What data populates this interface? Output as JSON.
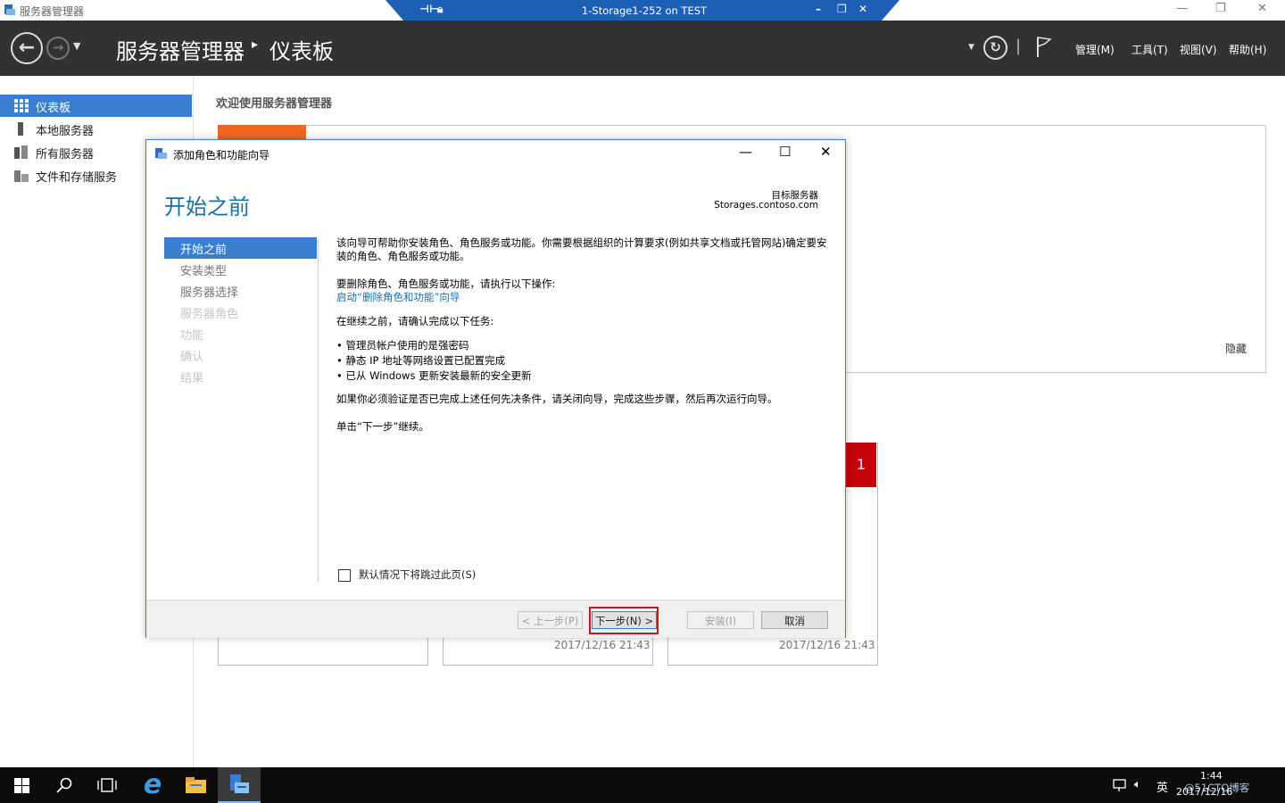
{
  "window": {
    "title": "服务器管理器"
  },
  "rdp": {
    "title": "1-Storage1-252 on TEST"
  },
  "header": {
    "breadcrumb_root": "服务器管理器",
    "breadcrumb_sep": "▸",
    "breadcrumb_page": "仪表板",
    "menu": [
      "管理(M)",
      "工具(T)",
      "视图(V)",
      "帮助(H)"
    ]
  },
  "sidebar": {
    "items": [
      {
        "label": "仪表板",
        "icon": "dashboard-icon",
        "active": true
      },
      {
        "label": "本地服务器",
        "icon": "server-icon"
      },
      {
        "label": "所有服务器",
        "icon": "servers-icon"
      },
      {
        "label": "文件和存储服务",
        "icon": "storage-icon"
      }
    ]
  },
  "dashboard": {
    "welcome": "欢迎使用服务器管理器",
    "hide": "隐藏",
    "badge_count": "1",
    "tile_timestamps": [
      "2017/12/16 21:43",
      "2017/12/16 21:43"
    ]
  },
  "dialog": {
    "title": "添加角色和功能向导",
    "heading": "开始之前",
    "dest_label": "目标服务器",
    "dest_server": "Storages.contoso.com",
    "steps": [
      {
        "label": "开始之前",
        "state": "active"
      },
      {
        "label": "安装类型",
        "state": "enabled"
      },
      {
        "label": "服务器选择",
        "state": "enabled"
      },
      {
        "label": "服务器角色",
        "state": "disabled"
      },
      {
        "label": "功能",
        "state": "disabled"
      },
      {
        "label": "确认",
        "state": "disabled"
      },
      {
        "label": "结果",
        "state": "disabled"
      }
    ],
    "intro": "该向导可帮助你安装角色、角色服务或功能。你需要根据组织的计算要求(例如共享文档或托管网站)确定要安装的角色、角色服务或功能。",
    "remove_text": "要删除角色、角色服务或功能，请执行以下操作:",
    "remove_link": "启动“删除角色和功能”向导",
    "confirm_text": "在继续之前，请确认完成以下任务:",
    "bullets": [
      "管理员帐户使用的是强密码",
      "静态 IP 地址等网络设置已配置完成",
      "已从 Windows 更新安装最新的安全更新"
    ],
    "verify_text": "如果你必须验证是否已完成上述任何先决条件，请关闭向导，完成这些步骤，然后再次运行向导。",
    "continue_text": "单击“下一步”继续。",
    "skip_label": "默认情况下将跳过此页(S)",
    "buttons": {
      "prev": "< 上一步(P)",
      "next": "下一步(N) >",
      "install": "安装(I)",
      "cancel": "取消"
    }
  },
  "taskbar": {
    "ime": "英",
    "time": "1:44",
    "date": "2017/12/16",
    "watermark": "@51CTO博客"
  }
}
